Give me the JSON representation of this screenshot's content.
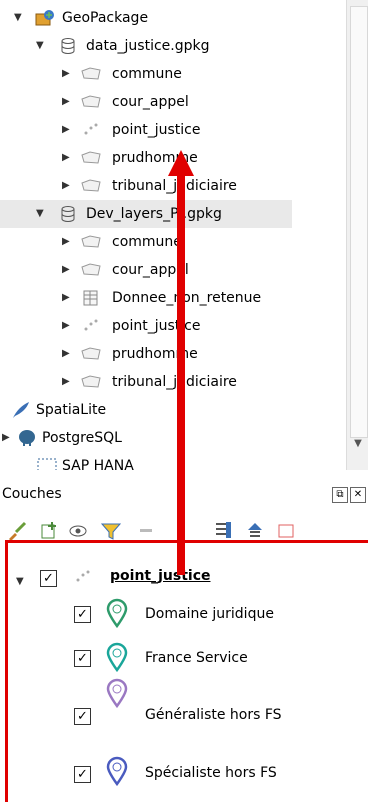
{
  "browser": {
    "items": [
      {
        "label": "GeoPackage"
      },
      {
        "label": "data_justice.gpkg"
      },
      {
        "label": "commune"
      },
      {
        "label": "cour_appel"
      },
      {
        "label": "point_justice"
      },
      {
        "label": "prudhomme"
      },
      {
        "label": "tribunal_judiciaire"
      },
      {
        "label": "Dev_layers_PJ.gpkg"
      },
      {
        "label": "commune"
      },
      {
        "label": "cour_appel"
      },
      {
        "label": "Donnee_non_retenue"
      },
      {
        "label": "point_justice"
      },
      {
        "label": "prudhomme"
      },
      {
        "label": "tribunal_judiciaire"
      },
      {
        "label": "SpatiaLite"
      },
      {
        "label": "PostgreSQL"
      },
      {
        "label": "SAP HANA"
      }
    ]
  },
  "couches": {
    "title": "Couches"
  },
  "layer": {
    "name": "point_justice",
    "checked": true,
    "categories": [
      {
        "label": "Domaine juridique",
        "color": "#2e9b6b"
      },
      {
        "label": "France Service",
        "color": "#1aa69a"
      },
      {
        "label": "Généraliste hors FS",
        "color": "#9a78c2"
      },
      {
        "label": "Spécialiste hors FS",
        "color": "#4a5bbf"
      }
    ]
  },
  "colors": {
    "annotation": "#e00000",
    "selection": "#e9e9e9"
  }
}
